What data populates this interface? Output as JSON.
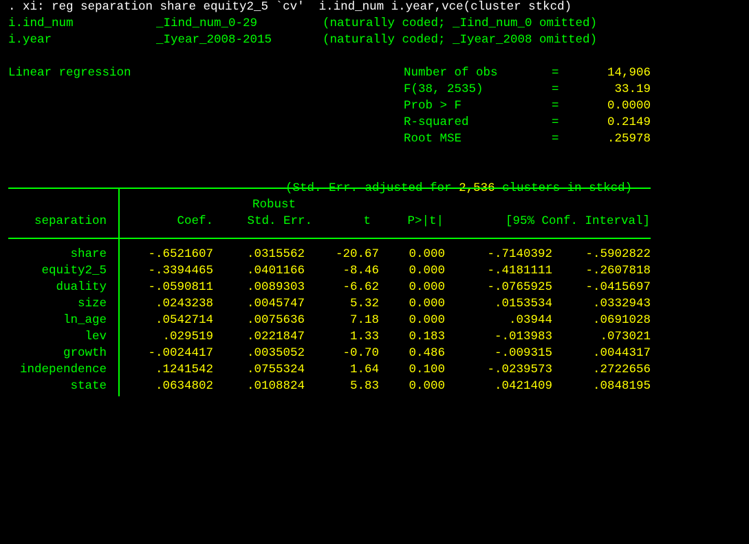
{
  "command_line": ". xi: reg separation share equity2_5 `cv'  i.ind_num i.year,vce(cluster stkcd)",
  "xi_expansion": [
    {
      "term": "i.ind_num",
      "dummies": "_Iind_num_0-29",
      "note": "(naturally coded; _Iind_num_0 omitted)"
    },
    {
      "term": "i.year",
      "dummies": "_Iyear_2008-2015",
      "note": "(naturally coded; _Iyear_2008 omitted)"
    }
  ],
  "model_title": "Linear regression",
  "stats": [
    {
      "label": "Number of obs",
      "eq": "=",
      "value": "14,906"
    },
    {
      "label": "F(38, 2535)",
      "eq": "=",
      "value": "33.19"
    },
    {
      "label": "Prob > F",
      "eq": "=",
      "value": "0.0000"
    },
    {
      "label": "R-squared",
      "eq": "=",
      "value": "0.2149"
    },
    {
      "label": "Root MSE",
      "eq": "=",
      "value": ".25978"
    }
  ],
  "cluster_note": {
    "prefix": "(Std. Err. adjusted for ",
    "count": "2,536",
    "suffix": " clusters in stkcd)"
  },
  "table": {
    "header_top": "Robust",
    "dep_var": "separation",
    "columns": [
      "Coef.",
      "Std. Err.",
      "t",
      "P>|t|",
      "[95% Conf. Interval]"
    ],
    "rows": [
      {
        "name": "share",
        "coef": "-.6521607",
        "se": ".0315562",
        "t": "-20.67",
        "p": "0.000",
        "lo": "-.7140392",
        "hi": "-.5902822"
      },
      {
        "name": "equity2_5",
        "coef": "-.3394465",
        "se": ".0401166",
        "t": "-8.46",
        "p": "0.000",
        "lo": "-.4181111",
        "hi": "-.2607818"
      },
      {
        "name": "duality",
        "coef": "-.0590811",
        "se": ".0089303",
        "t": "-6.62",
        "p": "0.000",
        "lo": "-.0765925",
        "hi": "-.0415697"
      },
      {
        "name": "size",
        "coef": ".0243238",
        "se": ".0045747",
        "t": "5.32",
        "p": "0.000",
        "lo": ".0153534",
        "hi": ".0332943"
      },
      {
        "name": "ln_age",
        "coef": ".0542714",
        "se": ".0075636",
        "t": "7.18",
        "p": "0.000",
        "lo": ".03944",
        "hi": ".0691028"
      },
      {
        "name": "lev",
        "coef": ".029519",
        "se": ".0221847",
        "t": "1.33",
        "p": "0.183",
        "lo": "-.013983",
        "hi": ".073021"
      },
      {
        "name": "growth",
        "coef": "-.0024417",
        "se": ".0035052",
        "t": "-0.70",
        "p": "0.486",
        "lo": "-.009315",
        "hi": ".0044317"
      },
      {
        "name": "independence",
        "coef": ".1241542",
        "se": ".0755324",
        "t": "1.64",
        "p": "0.100",
        "lo": "-.0239573",
        "hi": ".2722656"
      },
      {
        "name": "state",
        "coef": ".0634802",
        "se": ".0108824",
        "t": "5.83",
        "p": "0.000",
        "lo": ".0421409",
        "hi": ".0848195"
      }
    ]
  },
  "colors": {
    "background": "#000000",
    "command": "#ffffff",
    "text": "#00ff00",
    "numbers": "#ffff00"
  }
}
